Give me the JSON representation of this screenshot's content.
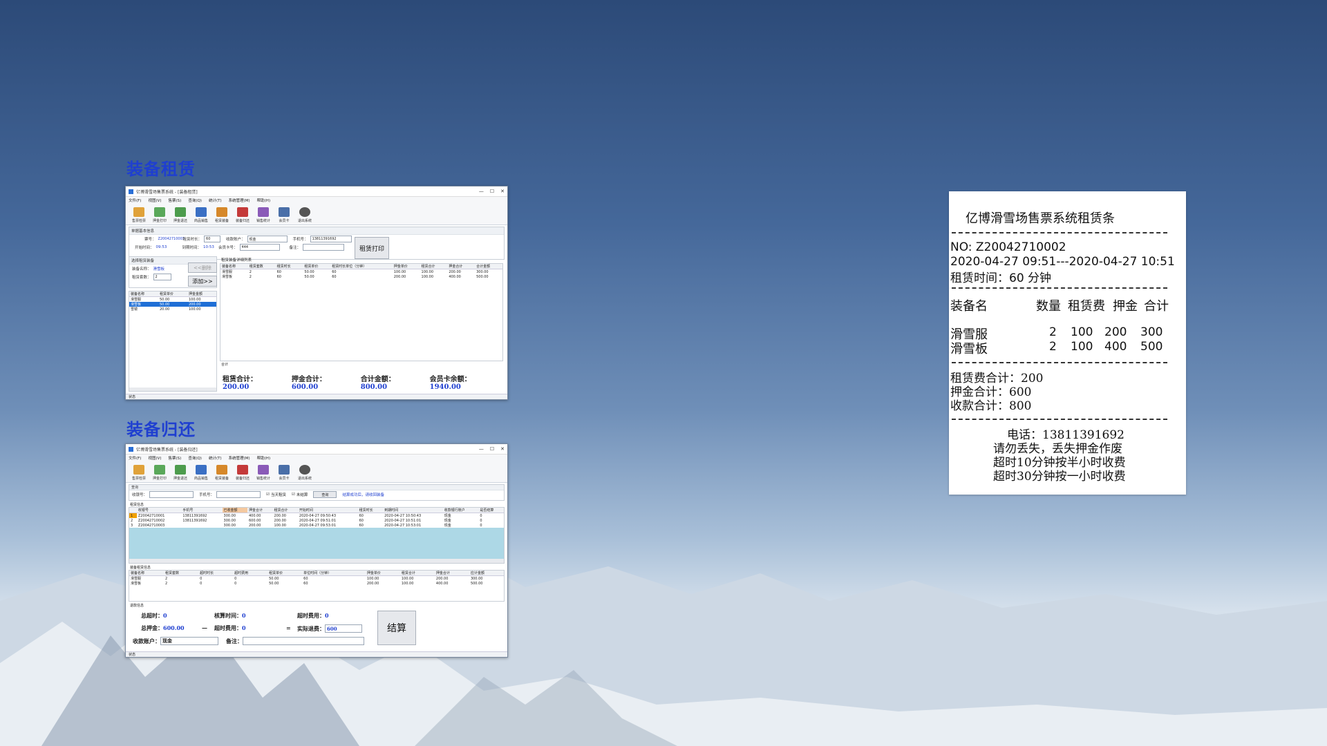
{
  "section_titles": {
    "rental": "装备租赁",
    "return": "装备归还"
  },
  "win_common": {
    "title1": "亿博滑雪场售票系统 - [装备租赁]",
    "title2": "亿博滑雪场售票系统 - [装备归还]",
    "menus": [
      "文件(F)",
      "视图(V)",
      "售票(S)",
      "查询(Q)",
      "统计(T)",
      "系统管理(M)",
      "帮助(H)"
    ],
    "toolbar": [
      "售票检票",
      "押金打印",
      "押金退还",
      "商品销售",
      "租赁装备",
      "装备归还",
      "销售统计",
      "会员卡",
      "退出系统"
    ]
  },
  "rental": {
    "group_basic": "单据基本信息",
    "ticket_label": "票号：",
    "ticket_value": "Z20042710003",
    "rent_time_label": "租赁时长：",
    "rent_time_value": "60",
    "account_label": "收款账户：",
    "account_value": "现金",
    "phone_label": "手机号：",
    "phone_value": "13811391692",
    "start_label": "开始时间：",
    "start_value": "09:53",
    "end_label": "到期时间：",
    "end_value": "10:53",
    "member_label": "会员卡号：",
    "member_value": "444",
    "note_label": "备注：",
    "print_button": "租赁打印",
    "group_select": "选择租赁装备",
    "equip_label": "装备名称：",
    "equip_value": "滑雪板",
    "delete_button": "<<删除",
    "count_label": "租赁套数：",
    "count_value": "2",
    "add_button": "添加>>",
    "left_columns": [
      "装备名称",
      "租赁单价",
      "押金金额"
    ],
    "left_rows": [
      [
        "滑雪服",
        "50.00",
        "100.00"
      ],
      [
        "滑雪板",
        "50.00",
        "200.00"
      ],
      [
        "雪镜",
        "20.00",
        "100.00"
      ]
    ],
    "group_list": "租赁装备详细列表",
    "list_columns": [
      "装备名称",
      "租赁套数",
      "租赁时长",
      "租赁单价",
      "租赁时长单位（分钟）",
      "押金单价",
      "租赁合计",
      "押金合计",
      "合计金额"
    ],
    "list_rows": [
      [
        "滑雪服",
        "2",
        "60",
        "50.00",
        "60",
        "100.00",
        "100.00",
        "200.00",
        "300.00"
      ],
      [
        "滑雪板",
        "2",
        "60",
        "50.00",
        "60",
        "200.00",
        "100.00",
        "400.00",
        "500.00"
      ]
    ],
    "total_group": "合计",
    "rent_total_label": "租赁合计：",
    "rent_total": "200.00",
    "deposit_total_label": "押金合计：",
    "deposit_total": "600.00",
    "amount_total_label": "合计金额：",
    "amount_total": "800.00",
    "card_balance_label": "会员卡余额：",
    "card_balance": "1940.00",
    "status": "状态"
  },
  "return": {
    "group_query": "查询",
    "order_label": "收银号：",
    "phone_label": "手机号：",
    "today_label": "当天租赁",
    "unsettled_label": "未结算",
    "query_button": "查询",
    "hint": "结算成功后，请收回装备",
    "group_info": "租赁信息",
    "columns": [
      "收银号",
      "手机号",
      "已收金额",
      "押金合计",
      "租赁合计",
      "开始时间",
      "租赁时长",
      "到期时间",
      "收款银行账户",
      "是否结算"
    ],
    "rows": [
      [
        "Z20042710001",
        "13811391692",
        "300.00",
        "400.00",
        "200.00",
        "2020-04-27 09:50:43",
        "60",
        "2020-04-27 10:50:43",
        "现金",
        "0"
      ],
      [
        "Z20042710002",
        "13811391692",
        "300.00",
        "600.00",
        "200.00",
        "2020-04-27 09:51:01",
        "60",
        "2020-04-27 10:51:01",
        "现金",
        "0"
      ],
      [
        "Z20042710003",
        "",
        "300.00",
        "200.00",
        "100.00",
        "2020-04-27 09:53:01",
        "60",
        "2020-04-27 10:53:01",
        "现金",
        "0"
      ]
    ],
    "group_detail": "装备租赁信息",
    "detail_columns": [
      "装备名称",
      "租赁套数",
      "超时时长",
      "超时费用",
      "租赁单价",
      "单位时间（分钟）",
      "押金单价",
      "租赁合计",
      "押金合计",
      "应计金额"
    ],
    "detail_rows": [
      [
        "滑雪服",
        "2",
        "0",
        "0",
        "50.00",
        "60",
        "100.00",
        "100.00",
        "200.00",
        "300.00"
      ],
      [
        "滑雪板",
        "2",
        "0",
        "0",
        "50.00",
        "60",
        "200.00",
        "100.00",
        "400.00",
        "500.00"
      ]
    ],
    "group_settle": "退款信息",
    "overtime_label": "总超时：",
    "overtime_value": "0",
    "calc_time_label": "核算时间：",
    "calc_time_value": "0",
    "overtime_fee_label": "超时费用：",
    "overtime_fee_value": "0",
    "deposit_label": "总押金：",
    "deposit_value": "600.00",
    "minus": "—",
    "overtime_fee2_label": "超时费用：",
    "overtime_fee2_value": "0",
    "equals": "=",
    "refund_label": "实际退费：",
    "refund_value": "600",
    "settle_button": "结算",
    "account_label": "收款账户：",
    "account_value": "现金",
    "note_label": "备注：",
    "status": "状态"
  },
  "receipt": {
    "title": "亿博滑雪场售票系统租赁条",
    "no": "NO:  Z20042710002",
    "period": "2020-04-27 09:51---2020-04-27 10:51",
    "duration": "租赁时间：60 分钟",
    "header": {
      "name": "装备名",
      "qty": "数量",
      "fee": "租赁费",
      "deposit": "押金",
      "total": "合计"
    },
    "items": [
      {
        "name": "滑雪服",
        "qty": "2",
        "fee": "100",
        "deposit": "200",
        "total": "300"
      },
      {
        "name": "滑雪板",
        "qty": "2",
        "fee": "100",
        "deposit": "400",
        "total": "500"
      }
    ],
    "fee_total": "租赁费合计：200",
    "deposit_total": "押金合计：600",
    "paid_total": "收款合计：800",
    "phone": "电话：13811391692",
    "notice1": "请勿丢失，丢失押金作废",
    "notice2": "超时10分钟按半小时收费",
    "notice3": "超时30分钟按一小时收费"
  }
}
